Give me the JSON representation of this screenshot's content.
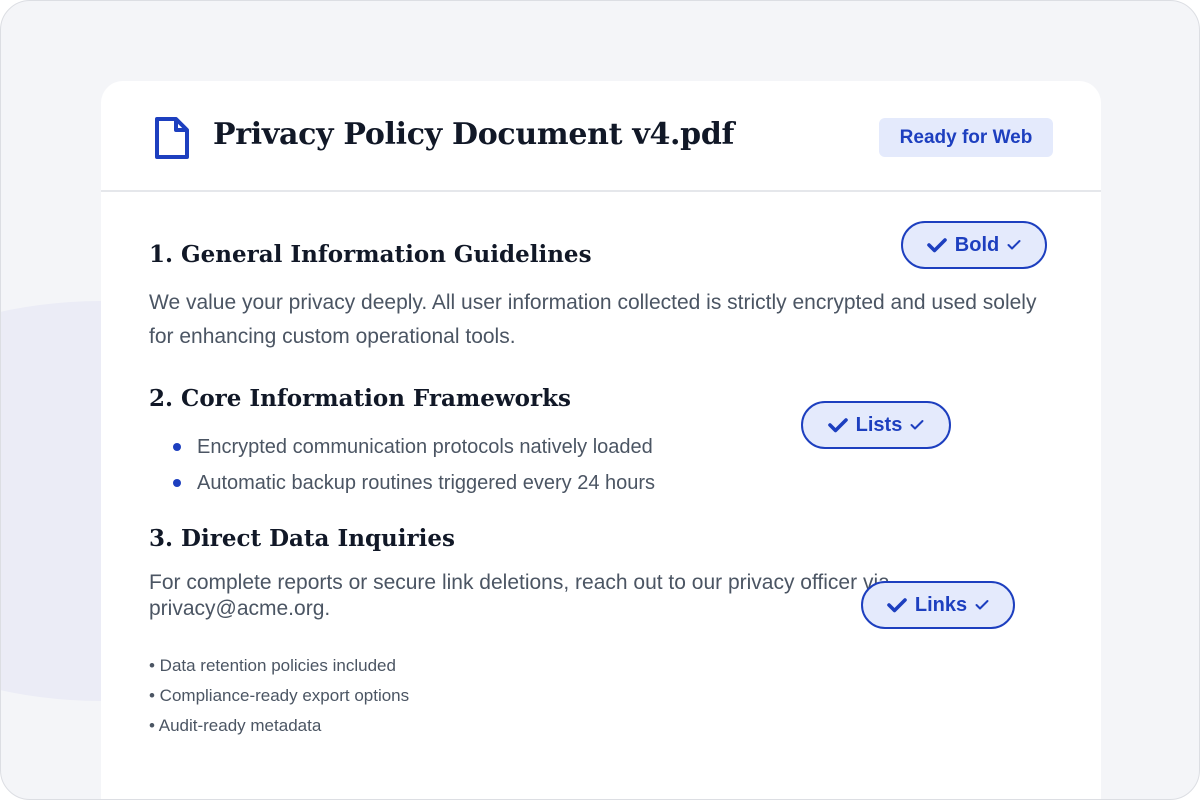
{
  "document": {
    "title": "Privacy Policy Document v4.pdf",
    "status": "Ready for Web",
    "icon": "file-icon"
  },
  "sections": [
    {
      "heading": "1. General Information Guidelines",
      "body": "We value your privacy deeply. All user information collected is strictly encrypted and used solely for enhancing custom operational tools."
    },
    {
      "heading": "2. Core Information Frameworks",
      "bullets": [
        "Encrypted communication protocols natively loaded",
        "Automatic backup routines triggered every 24 hours"
      ]
    },
    {
      "heading": "3. Direct Data Inquiries",
      "body": "For complete reports or secure link deletions, reach out to our privacy officer via privacy@acme.org."
    }
  ],
  "features": [
    "• Data retention policies included",
    "• Compliance-ready export options",
    "• Audit-ready metadata"
  ],
  "format_chips": [
    {
      "label": "Bold",
      "icon": "check-icon"
    },
    {
      "label": "Lists",
      "icon": "check-icon"
    },
    {
      "label": "Links",
      "icon": "check-icon"
    }
  ],
  "colors": {
    "accent": "#1d3fbf",
    "badge_bg": "#e4eafc",
    "heading": "#111827",
    "body_text": "#4b5563",
    "page_bg": "#f4f5f8"
  }
}
